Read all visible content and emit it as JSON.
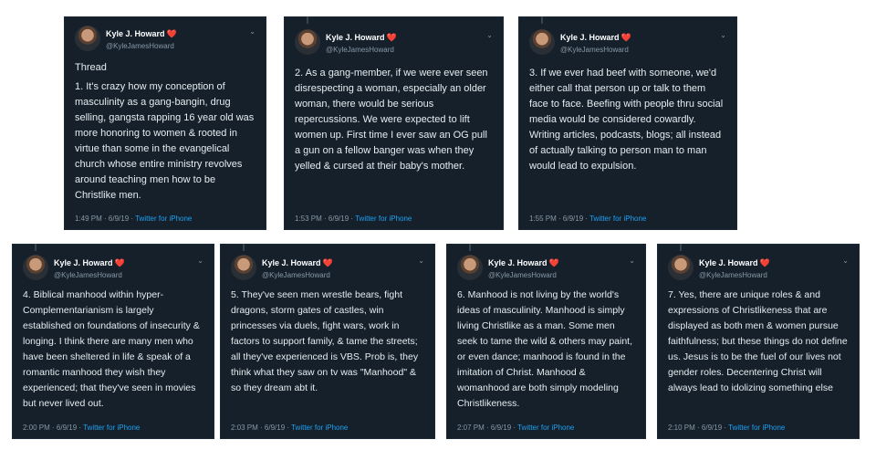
{
  "user": {
    "name": "Kyle J. Howard",
    "emoji": "❤️",
    "handle": "@KyleJamesHoward"
  },
  "tweets": [
    {
      "label": "Thread",
      "text": "1. It's crazy how my conception of masculinity as a gang-bangin, drug selling, gangsta rapping 16 year old was more honoring to women & rooted in virtue than some in the evangelical church whose entire ministry revolves around teaching men how to be Christlike men.",
      "time": "1:49 PM · 6/9/19 · ",
      "source": "Twitter for iPhone"
    },
    {
      "text": "2. As a gang-member, if we were ever seen disrespecting a woman, especially an older woman, there would be serious repercussions. We were expected to lift women up. First time I ever saw an OG pull a gun on a fellow banger was when they yelled & cursed at their baby's mother.",
      "time": "1:53 PM · 6/9/19 · ",
      "source": "Twitter for iPhone"
    },
    {
      "text": "3. If we ever had beef with someone, we'd either call that person up or talk to them face to face. Beefing with people thru social media would be considered cowardly. Writing articles, podcasts, blogs; all instead of actually talking to person man to man would lead to expulsion.",
      "time": "1:55 PM · 6/9/19 · ",
      "source": "Twitter for iPhone"
    },
    {
      "text": "4. Biblical manhood within hyper-Complementarianism is largely established on foundations of insecurity & longing. I think there are many men who have been sheltered in life & speak of a romantic manhood they wish they experienced; that they've seen in movies but never lived out.",
      "time": "2:00 PM · 6/9/19 · ",
      "source": "Twitter for iPhone"
    },
    {
      "text": "5. They've seen men wrestle bears, fight dragons, storm gates of castles, win princesses via duels, fight wars, work in factors to support family, & tame the streets; all they've experienced is VBS. Prob is, they think what they saw on tv was \"Manhood\" & so they dream abt it.",
      "time": "2:03 PM · 6/9/19 · ",
      "source": "Twitter for iPhone"
    },
    {
      "text": "6. Manhood is not living by the world's ideas of masculinity. Manhood is simply living Christlike as a man. Some men seek to tame the wild & others may paint, or even dance; manhood is found in the imitation of Christ. Manhood & womanhood are both simply modeling Christlikeness.",
      "time": "2:07 PM · 6/9/19 · ",
      "source": "Twitter for iPhone"
    },
    {
      "text": "7. Yes, there are unique roles & and expressions of Christlikeness that are displayed as both men & women pursue faithfulness; but these things do not define us. Jesus is to be the fuel of our lives not gender roles. Decentering Christ will always lead to idolizing something else",
      "time": "2:10 PM · 6/9/19 · ",
      "source": "Twitter for iPhone"
    }
  ]
}
